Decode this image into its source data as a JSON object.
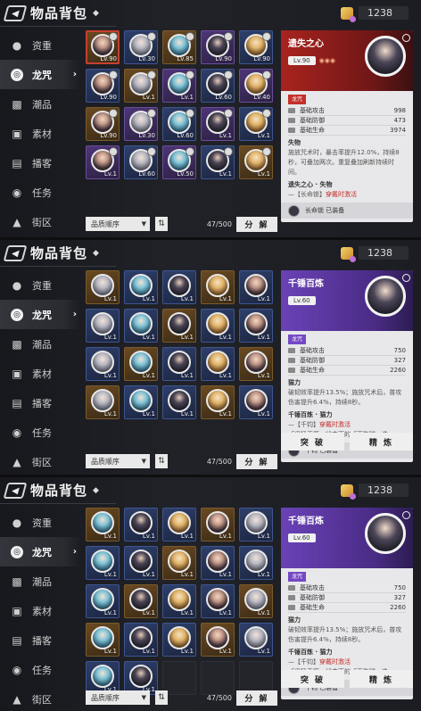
{
  "common": {
    "title": "物品背包",
    "currency": "1238",
    "sort_label": "品质顺序",
    "capacity": "47/500",
    "decompose": "分 解",
    "sidebar": [
      "资重",
      "龙咒",
      "潮品",
      "素材",
      "播客",
      "任务",
      "街区"
    ]
  },
  "panel1": {
    "grid": [
      [
        "Lv.90",
        "Lv.30",
        "Lv.85",
        "Lv.90",
        "Lv.90"
      ],
      [
        "Lv.90",
        "Lv.1",
        "Lv.1",
        "Lv.60",
        "Lv.40"
      ],
      [
        "Lv.90",
        "Lv.30",
        "Lv.60",
        "Lv.1",
        "Lv.1"
      ],
      [
        "Lv.1",
        "Lv.60",
        "Lv.50",
        "Lv.1",
        "Lv.1"
      ]
    ],
    "card": {
      "name": "遗失之心",
      "level": "Lv.90",
      "tag": "龙咒",
      "stats": [
        {
          "label": "基础攻击",
          "value": "998"
        },
        {
          "label": "基础防御",
          "value": "473"
        },
        {
          "label": "基础生命",
          "value": "3974"
        }
      ],
      "skill_title": "失物",
      "skill_desc": "施放咒术时，暴击率提升12.0%，持续8秒，可叠加两次。重复叠加刷新持续时间。",
      "set_title": "遗失之心 · 失物",
      "set_lines": [
        {
          "prefix": "—【长命锁】",
          "highlight": "穿戴时激活"
        }
      ],
      "equipped": "长命锁 已装备"
    }
  },
  "panel2": {
    "grid": [
      [
        "Lv.1",
        "Lv.1",
        "Lv.1",
        "Lv.1",
        "Lv.1"
      ],
      [
        "Lv.1",
        "Lv.1",
        "Lv.1",
        "Lv.1",
        "Lv.1"
      ],
      [
        "Lv.1",
        "Lv.1",
        "Lv.1",
        "Lv.1",
        "Lv.1"
      ],
      [
        "Lv.1",
        "Lv.1",
        "Lv.1",
        "Lv.1",
        "Lv.1"
      ]
    ],
    "card": {
      "name": "千锤百炼",
      "level": "Lv.60",
      "tag": "龙咒",
      "stats": [
        {
          "label": "基础攻击",
          "value": "750"
        },
        {
          "label": "基础防御",
          "value": "327"
        },
        {
          "label": "基础生命",
          "value": "2260"
        }
      ],
      "skill_title": "猫力",
      "skill_desc": "破韧效率提升13.5%；施放咒术后，普攻伤害提升6.4%，持续8秒。",
      "set_title": "千锤百炼 · 猫力",
      "set_lines": [
        {
          "prefix": "—【千钧】",
          "highlight": "穿戴时激活"
        },
        {
          "prefix": "「迅猛无匹」状态下的「百影腿」造",
          "highlight": ""
        }
      ],
      "equipped": "千钧 已装备",
      "btn_break": "突 破",
      "btn_refine": "精 炼"
    }
  },
  "panel3": {
    "grid": [
      [
        "Lv.1",
        "Lv.1",
        "Lv.1",
        "Lv.1",
        "Lv.1"
      ],
      [
        "Lv.1",
        "Lv.1",
        "Lv.1",
        "Lv.1",
        "Lv.1"
      ],
      [
        "Lv.1",
        "Lv.1",
        "Lv.1",
        "Lv.1",
        "Lv.1"
      ],
      [
        "Lv.1",
        "Lv.1",
        "Lv.1",
        "Lv.1",
        "Lv.1"
      ],
      [
        "Lv.1",
        "Lv.1",
        "",
        "",
        ""
      ]
    ],
    "card": {
      "name": "千锤百炼",
      "level": "Lv.60",
      "tag": "龙咒",
      "stats": [
        {
          "label": "基础攻击",
          "value": "750"
        },
        {
          "label": "基础防御",
          "value": "327"
        },
        {
          "label": "基础生命",
          "value": "2260"
        }
      ],
      "skill_title": "猫力",
      "skill_desc": "破韧效率提升13.5%；施放咒术后，普攻伤害提升6.4%，持续8秒。",
      "set_title": "千锤百炼 · 猫力",
      "set_lines": [
        {
          "prefix": "—【千钧】",
          "highlight": "穿戴时激活"
        },
        {
          "prefix": "「迅猛无匹」状态下的「百影腿」造",
          "highlight": ""
        }
      ],
      "equipped": "千钧 已装备",
      "btn_break": "突 破",
      "btn_refine": "精 炼"
    }
  },
  "colors": {
    "accent_red": "#c4302a",
    "accent_violet": "#7448c4"
  }
}
